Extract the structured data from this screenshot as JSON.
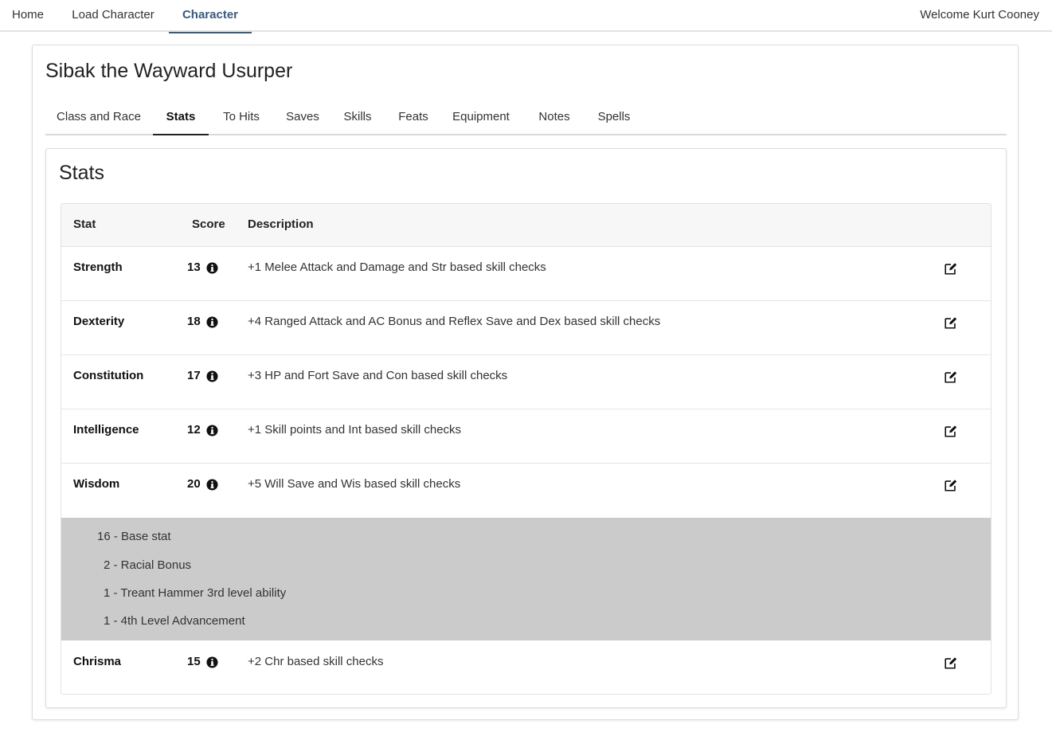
{
  "nav": {
    "home": "Home",
    "load_character": "Load Character",
    "character": "Character",
    "welcome": "Welcome Kurt Cooney"
  },
  "character": {
    "name": "Sibak the Wayward Usurper"
  },
  "tabs": [
    {
      "label": "Class and Race",
      "active": false
    },
    {
      "label": "Stats",
      "active": true
    },
    {
      "label": "To Hits",
      "active": false
    },
    {
      "label": "Saves",
      "active": false
    },
    {
      "label": "Skills",
      "active": false
    },
    {
      "label": "Feats",
      "active": false
    },
    {
      "label": "Equipment",
      "active": false
    },
    {
      "label": "Notes",
      "active": false
    },
    {
      "label": "Spells",
      "active": false
    }
  ],
  "stats": {
    "title": "Stats",
    "columns": {
      "stat": "Stat",
      "score": "Score",
      "description": "Description"
    },
    "rows": [
      {
        "stat": "Strength",
        "score": "13",
        "description": "+1 Melee Attack and Damage and Str based skill checks"
      },
      {
        "stat": "Dexterity",
        "score": "18",
        "description": "+4 Ranged Attack and AC Bonus and Reflex Save and Dex based skill checks"
      },
      {
        "stat": "Constitution",
        "score": "17",
        "description": "+3 HP and Fort Save and Con based skill checks"
      },
      {
        "stat": "Intelligence",
        "score": "12",
        "description": "+1 Skill points and Int based skill checks"
      },
      {
        "stat": "Wisdom",
        "score": "20",
        "description": "+5 Will Save and Wis based skill checks"
      },
      {
        "stat": "Chrisma",
        "score": "15",
        "description": "+2 Chr based skill checks"
      }
    ],
    "breakdown": [
      "16 - Base stat",
      "2 - Racial Bonus",
      "1 - Treant Hammer 3rd level ability",
      "1 - 4th Level Advancement"
    ]
  },
  "colors": {
    "accent": "#3a5a7e",
    "breakdown_bg": "#cbcbcb",
    "header_bg": "#f7f7f7"
  },
  "icons": {
    "info": "info-circle-icon",
    "edit": "edit-icon"
  }
}
